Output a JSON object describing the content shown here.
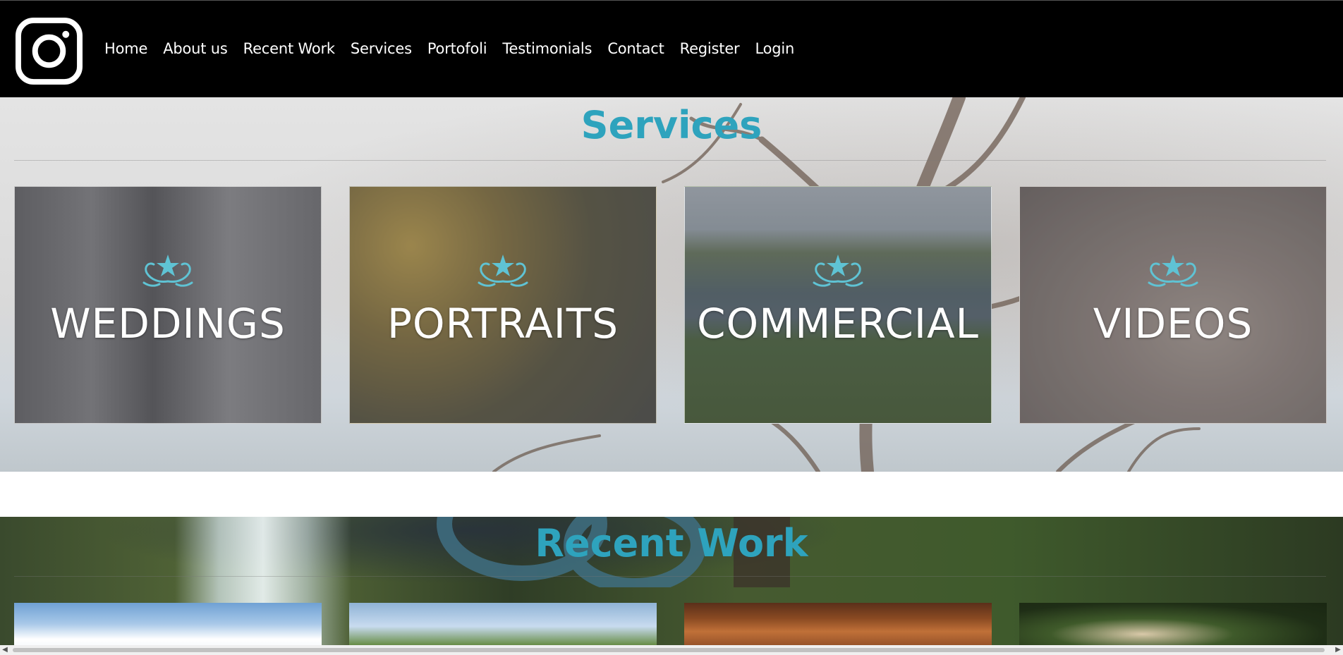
{
  "nav": {
    "logo_icon": "instagram-icon",
    "links": [
      "Home",
      "About us",
      "Recent Work",
      "Services",
      "Portofoli",
      "Testimonials",
      "Contact",
      "Register",
      "Login"
    ]
  },
  "services": {
    "title": "Services",
    "cards": [
      {
        "label": "WEDDINGS",
        "emblem": "star-emblem-icon"
      },
      {
        "label": "PORTRAITS",
        "emblem": "star-emblem-icon"
      },
      {
        "label": "COMMERCIAL",
        "emblem": "star-emblem-icon"
      },
      {
        "label": "VIDEOS",
        "emblem": "star-emblem-icon"
      }
    ]
  },
  "recent_work": {
    "title": "Recent Work"
  },
  "colors": {
    "accent": "#2ea3bd",
    "nav_bg": "#000000",
    "emblem": "#5fc3d4"
  }
}
